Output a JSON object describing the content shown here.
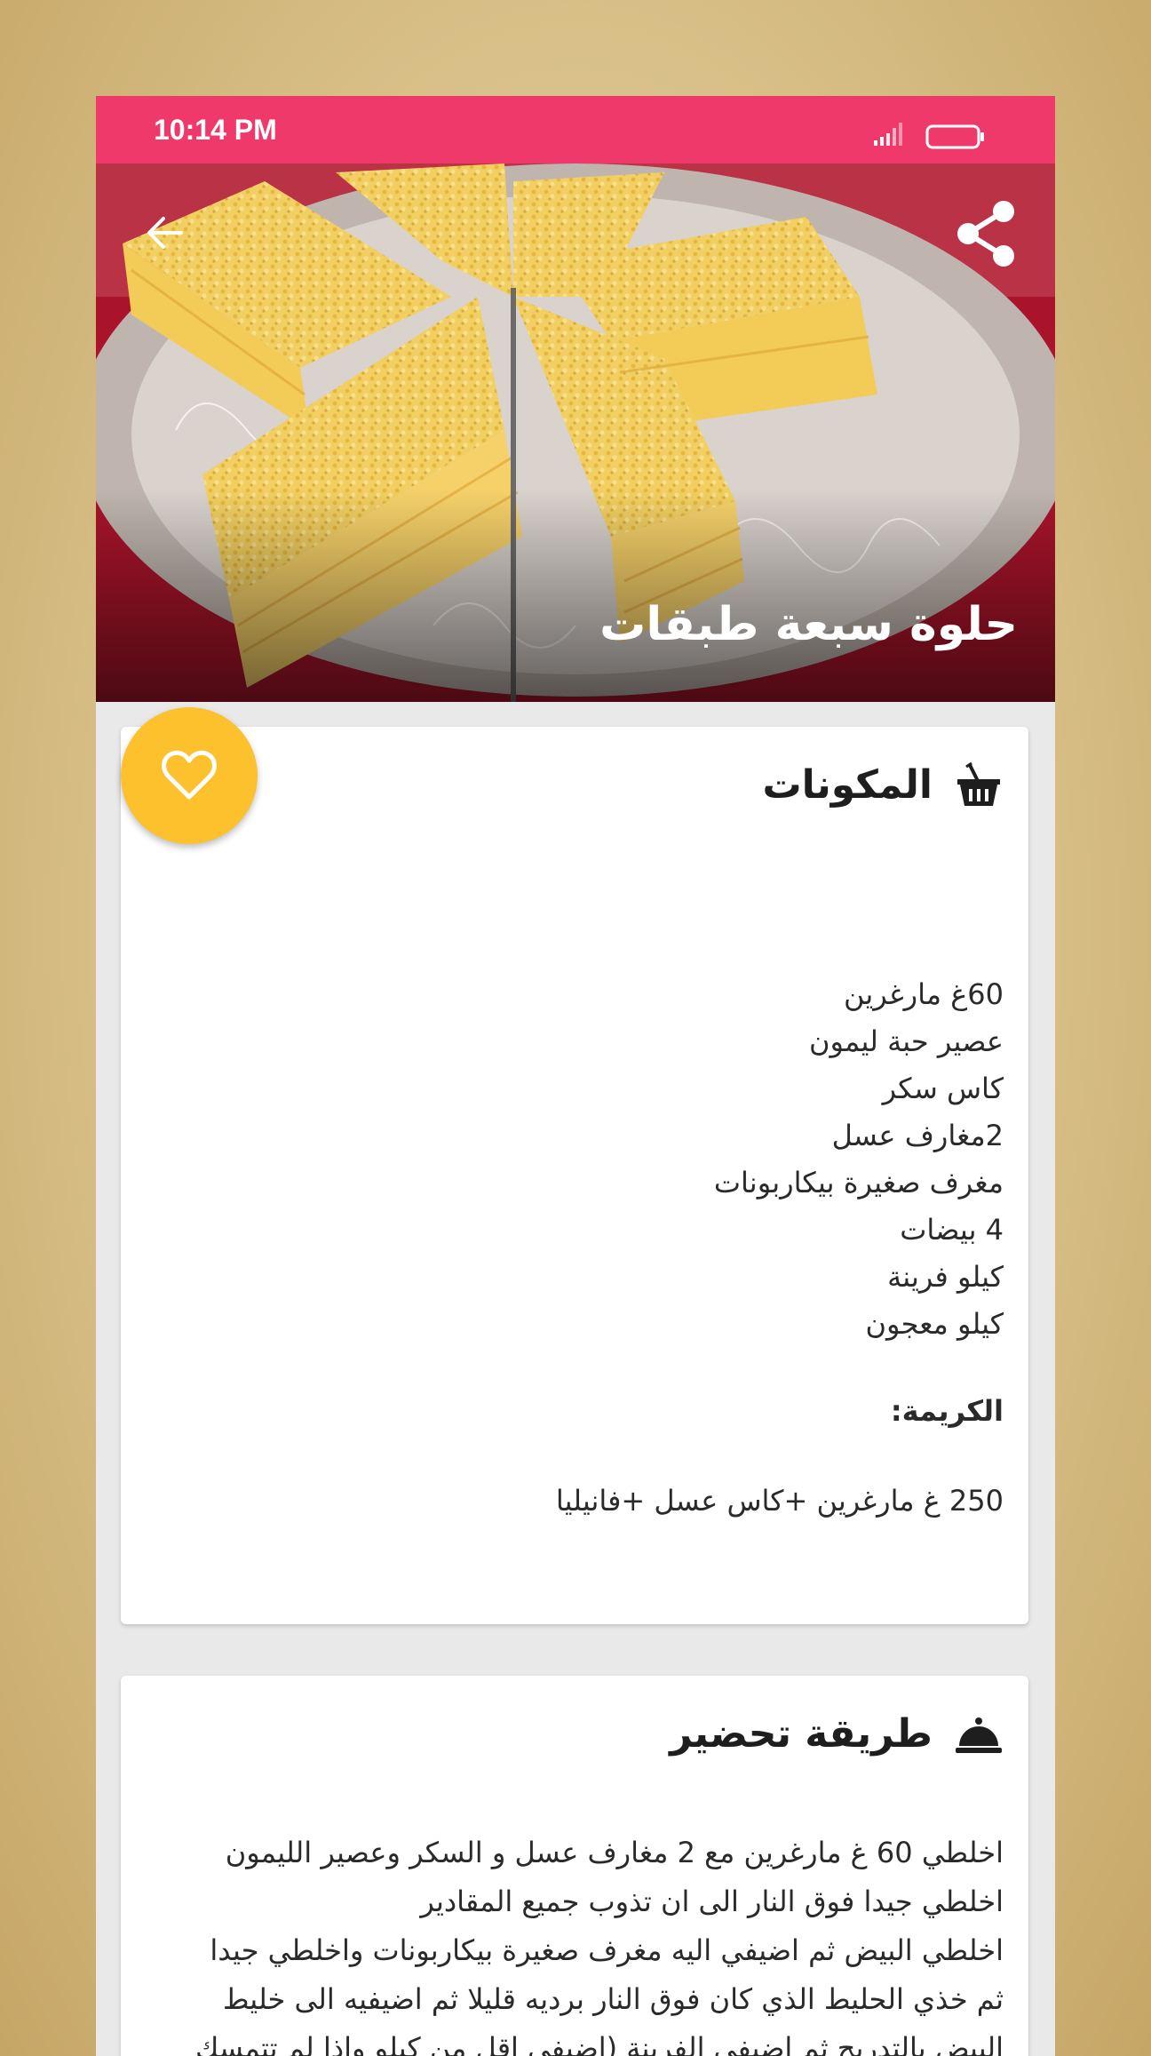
{
  "status_bar": {
    "time": "10:14 PM",
    "signal_icon": "signal-bars-icon",
    "battery_icon": "battery-icon"
  },
  "header": {
    "back_icon": "arrow-left-icon",
    "share_icon": "share-icon",
    "recipe_title": "حلوة سبعة طبقات",
    "hero_image": "layered-semolina-cake-photo"
  },
  "ingredients": {
    "icon": "basket-icon",
    "title": "المكونات",
    "items": [
      "60غ مارغرين",
      "عصير حبة ليمون",
      "كاس سكر",
      "2مغارف عسل",
      "مغرف صغيرة بيكاربونات",
      "4 بيضات",
      "كيلو فرينة",
      "كيلو معجون"
    ],
    "cream_heading": "الكريمة:",
    "cream_text": "250 غ مارغرين +كاس عسل +فانيليا"
  },
  "method": {
    "icon": "serving-cloche-icon",
    "title": "طريقة تحضير",
    "lines": [
      "اخلطي 60 غ مارغرين مع 2 مغارف عسل و السكر وعصير الليمون",
      "اخلطي جيدا فوق النار الى ان تذوب جميع المقادير",
      "اخلطي البيض ثم اضيفي اليه مغرف صغيرة بيكاربونات واخلطي جيدا",
      "ثم خذي الحليط الذي كان فوق النار برديه قليلا ثم اضيفيه الى خليط",
      "البيض بالتدريج ثم اضيفي الفرينة (اضيفي اقل من كيلو واذا لم تتمسك"
    ]
  },
  "favorite": {
    "icon": "heart-outline-icon"
  },
  "colors": {
    "status_bar": "#f0396b",
    "favorite_fab": "#fdc12d",
    "card_background": "#ffffff",
    "page_background": "#e9e9ea"
  }
}
